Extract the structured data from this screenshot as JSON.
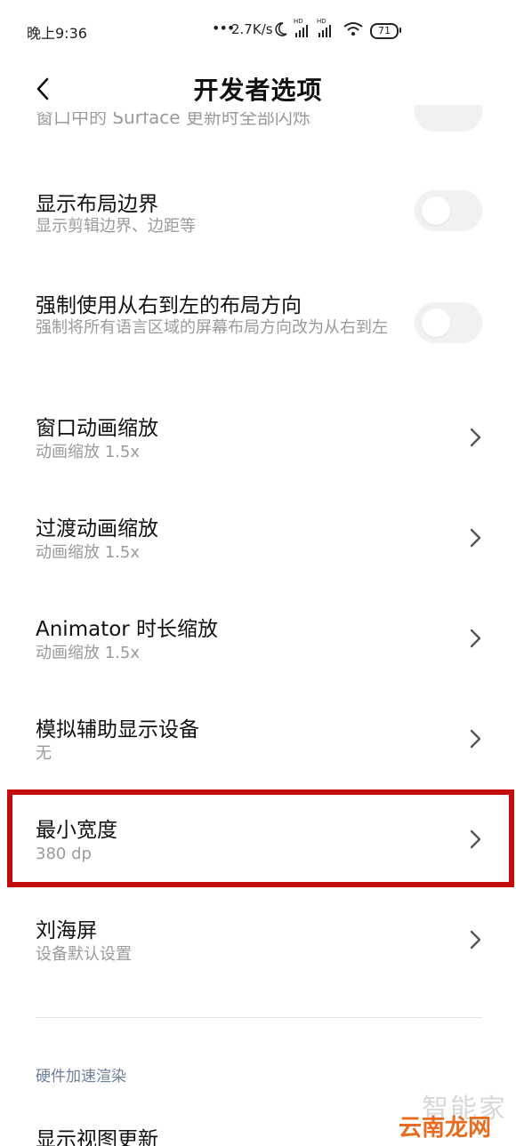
{
  "status_bar": {
    "time": "晚上9:36",
    "network_speed": "2.7K/s",
    "battery": "71",
    "icons": [
      "more-dots-icon",
      "moon-icon",
      "hd-signal-icon",
      "hd-signal-icon",
      "wifi-icon",
      "battery-icon"
    ]
  },
  "header": {
    "title": "开发者选项",
    "back_icon": "chevron-left-icon"
  },
  "partial_item": {
    "subtitle": "窗口中的 Surface 更新时全部闪烁"
  },
  "items": [
    {
      "title": "显示布局边界",
      "subtitle": "显示剪辑边界、边距等",
      "control": "toggle",
      "state": "off"
    },
    {
      "title": "强制使用从右到左的布局方向",
      "subtitle": "强制将所有语言区域的屏幕布局方向改为从右到左",
      "control": "toggle",
      "state": "off"
    },
    {
      "title": "窗口动画缩放",
      "subtitle": "动画缩放 1.5x",
      "control": "chevron"
    },
    {
      "title": "过渡动画缩放",
      "subtitle": "动画缩放 1.5x",
      "control": "chevron"
    },
    {
      "title": "Animator 时长缩放",
      "subtitle": "动画缩放 1.5x",
      "control": "chevron"
    },
    {
      "title": "模拟辅助显示设备",
      "subtitle": "无",
      "control": "chevron"
    },
    {
      "title": "最小宽度",
      "subtitle": "380 dp",
      "control": "chevron",
      "highlighted": true
    },
    {
      "title": "刘海屏",
      "subtitle": "设备默认设置",
      "control": "chevron"
    }
  ],
  "section": {
    "header": "硬件加速渲染",
    "first_item_title": "显示视图更新"
  },
  "watermark": {
    "top": "智能家",
    "bottom": "云南龙网"
  },
  "colors": {
    "highlight": "#c40d0d",
    "section_header": "#6e7f9a",
    "subtitle": "#9a9a9a",
    "toggle_off": "#f1f1f1",
    "watermark_orange": "#e86b1f"
  }
}
